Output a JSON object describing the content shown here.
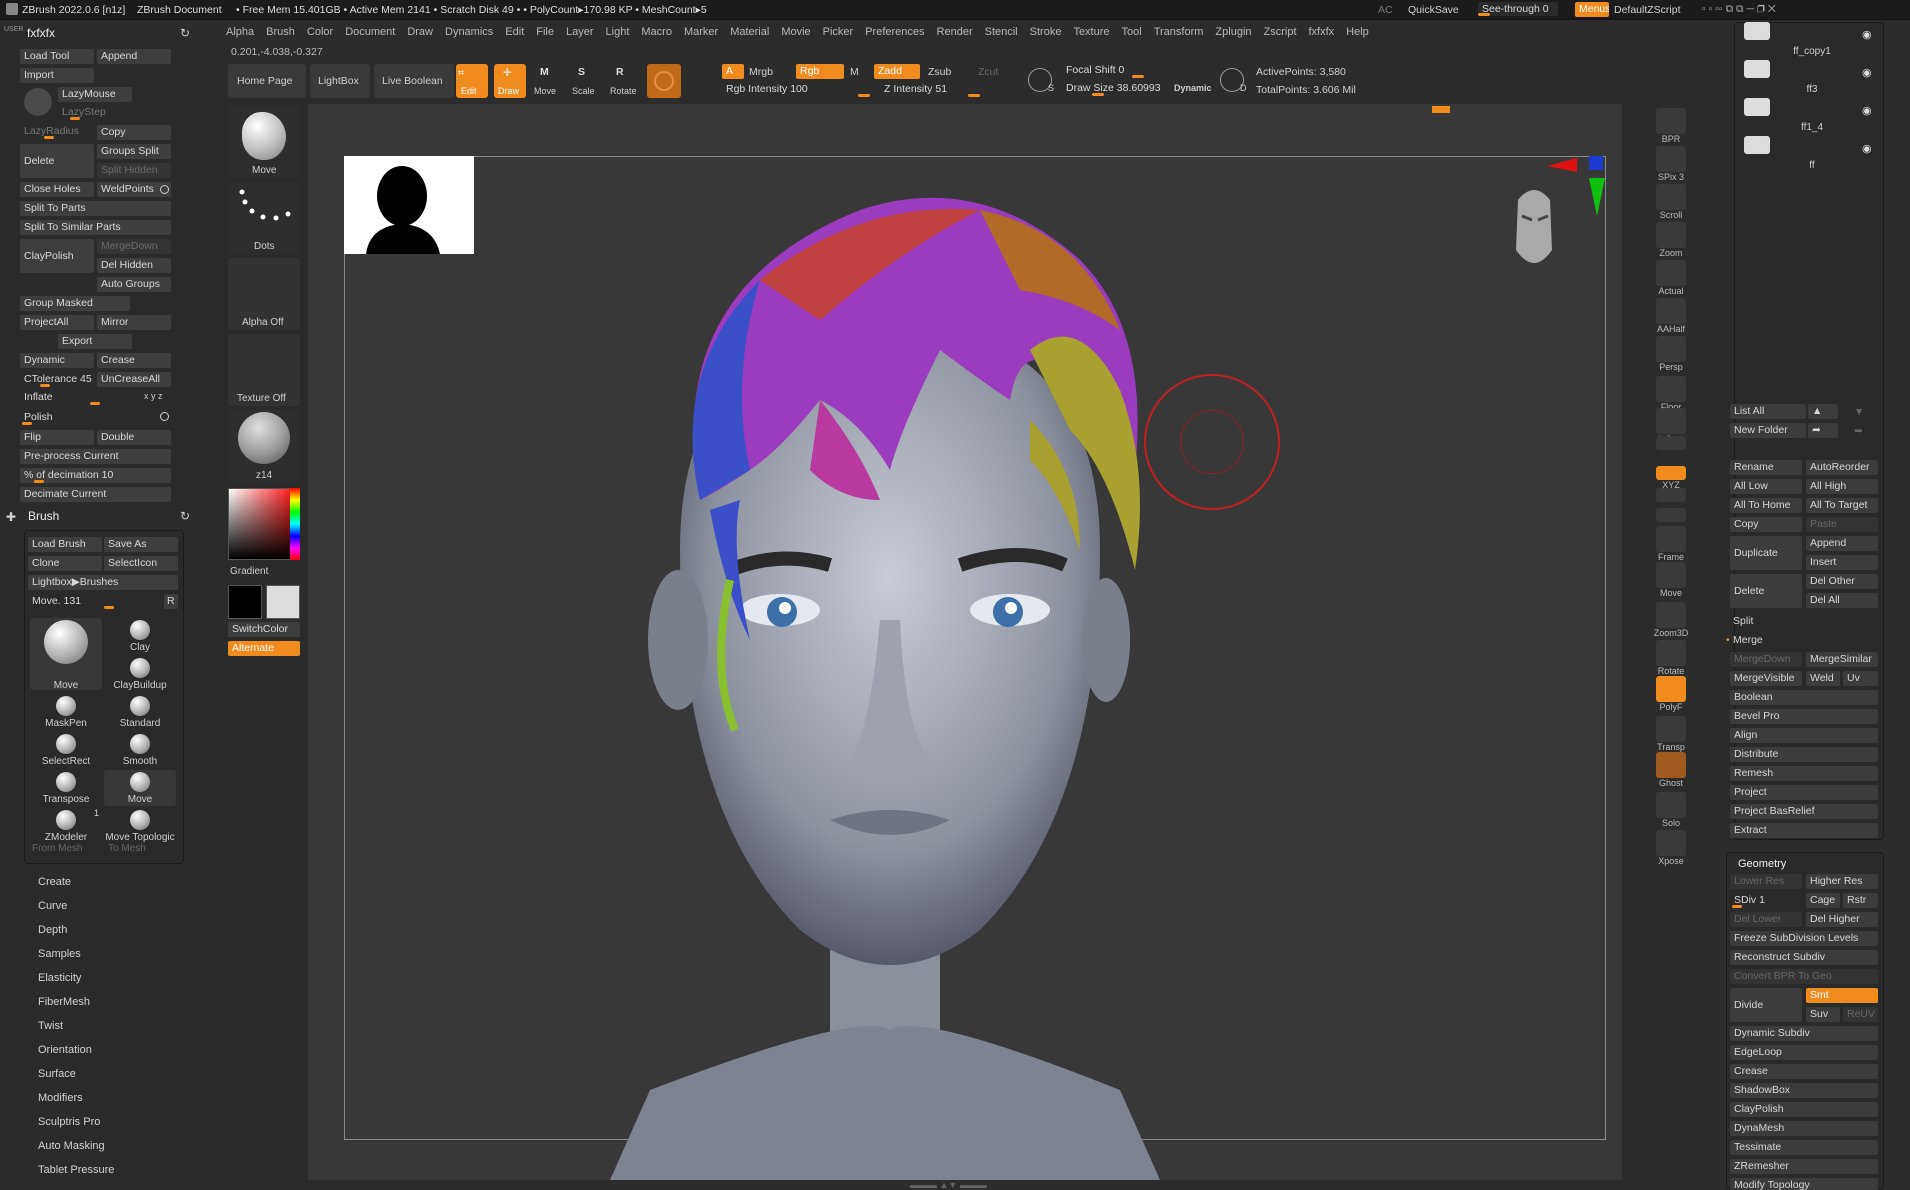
{
  "topbar": {
    "app": "ZBrush 2022.0.6 [n1z]",
    "doc": "ZBrush Document",
    "stats": "• Free Mem 15.401GB • Active Mem 2141 • Scratch Disk 49 •  • PolyCount▸170.98 KP  • MeshCount▸5",
    "ac": "AC",
    "quicksave": "QuickSave",
    "seethrough": "See-through  0",
    "menus": "Menus",
    "script": "DefaultZScript"
  },
  "menus": [
    "Alpha",
    "Brush",
    "Color",
    "Document",
    "Draw",
    "Dynamics",
    "Edit",
    "File",
    "Layer",
    "Light",
    "Macro",
    "Marker",
    "Material",
    "Movie",
    "Picker",
    "Preferences",
    "Render",
    "Stencil",
    "Stroke",
    "Texture",
    "Tool",
    "Transform",
    "Zplugin",
    "Zscript",
    "fxfxfx",
    "Help"
  ],
  "coords": "0.201,-4.038,-0.327",
  "toolbar": {
    "home": "Home Page",
    "lightbox": "LightBox",
    "live_boolean": "Live Boolean",
    "edit": "Edit",
    "draw": "Draw",
    "move": "Move",
    "scale": "Scale",
    "rotate": "Rotate",
    "a": "A",
    "mrgb": "Mrgb",
    "rgb": "Rgb",
    "m": "M",
    "zadd": "Zadd",
    "zsub": "Zsub",
    "zcut": "Zcut",
    "rgb_intensity": "Rgb Intensity  100",
    "z_intensity": "Z Intensity  51",
    "focal_shift": "Focal Shift  0",
    "draw_size": "Draw Size  38.60993",
    "dynamic": "Dynamic",
    "active_points": "ActivePoints: 3,580",
    "total_points": "TotalPoints: 3.606 Mil"
  },
  "left": {
    "title": "fxfxfx",
    "user": "USER",
    "load_tool": "Load Tool",
    "append": "Append",
    "import": "Import",
    "lazymouse": "LazyMouse",
    "lazystep": "LazyStep",
    "lazyradius": "LazyRadius",
    "copy": "Copy",
    "delete": "Delete",
    "groups_split": "Groups Split",
    "split_hidden": "Split Hidden",
    "close_holes": "Close Holes",
    "weldpoints": "WeldPoints",
    "split_to_parts": "Split To Parts",
    "split_similar": "Split To Similar Parts",
    "claypolish": "ClayPolish",
    "mergedown": "MergeDown",
    "del_hidden": "Del Hidden",
    "auto_groups": "Auto Groups",
    "group_masked": "Group Masked",
    "projectall": "ProjectAll",
    "mirror": "Mirror",
    "export": "Export",
    "dynamic": "Dynamic",
    "crease": "Crease",
    "ctolerance": "CTolerance 45",
    "uncreaseall": "UnCreaseAll",
    "inflate": "Inflate",
    "xyz": "x y z",
    "polish": "Polish",
    "flip": "Flip",
    "double": "Double",
    "preprocess": "Pre-process Current",
    "pct_decimation": "% of decimation  10",
    "decimate": "Decimate Current"
  },
  "brush": {
    "title": "Brush",
    "load_brush": "Load Brush",
    "save_as": "Save As",
    "clone": "Clone",
    "selecticon": "SelectIcon",
    "lightbox_brushes": "Lightbox▶Brushes",
    "move_slider": "Move.  131",
    "r": "R",
    "items": [
      "Move",
      "Clay",
      "ClayBuildup",
      "MaskPen",
      "Standard",
      "SelectRect",
      "Smooth",
      "Transpose",
      "Move",
      "ZModeler",
      "Move Topologic"
    ],
    "one": "1",
    "from_mesh": "From Mesh",
    "to_mesh": "To Mesh"
  },
  "left_menu": [
    "Create",
    "Curve",
    "Depth",
    "Samples",
    "Elasticity",
    "FiberMesh",
    "Twist",
    "Orientation",
    "Surface",
    "Modifiers",
    "Sculptris Pro",
    "Auto Masking",
    "Tablet Pressure"
  ],
  "tools": {
    "move": "Move",
    "dots": "Dots",
    "alpha": "Alpha Off",
    "texture": "Texture Off",
    "material": "z14",
    "gradient": "Gradient",
    "switchcolor": "SwitchColor",
    "alternate": "Alternate"
  },
  "right_bar": [
    "BPR",
    "SPix 3",
    "Scroll",
    "Zoom",
    "Actual",
    "AAHalf",
    "Persp",
    "Floor",
    "L.Sym",
    "",
    "XYZ",
    "",
    "",
    "Frame",
    "Move",
    "Zoom3D",
    "Rotate",
    "PolyF",
    "Transp",
    "Ghost",
    "Solo",
    "Xpose"
  ],
  "subtools": {
    "items": [
      "ff_copy1",
      "ff3",
      "ff1_4",
      "ff"
    ]
  },
  "right": {
    "list_all": "List All",
    "new_folder": "New Folder",
    "rename": "Rename",
    "autoreorder": "AutoReorder",
    "all_low": "All Low",
    "all_high": "All High",
    "all_to_home": "All To Home",
    "all_to_target": "All To Target",
    "copy": "Copy",
    "paste": "Paste",
    "duplicate": "Duplicate",
    "append": "Append",
    "insert": "Insert",
    "delete": "Delete",
    "del_other": "Del Other",
    "del_all": "Del All",
    "split": "Split",
    "merge": "Merge",
    "mergedown": "MergeDown",
    "mergesimilar": "MergeSimilar",
    "mergevisible": "MergeVisible",
    "weld": "Weld",
    "uv": "Uv",
    "list": [
      "Boolean",
      "Bevel Pro",
      "Align",
      "Distribute",
      "Remesh",
      "Project",
      "Project BasRelief",
      "Extract"
    ]
  },
  "geometry": {
    "title": "Geometry",
    "lower_res": "Lower Res",
    "higher_res": "Higher Res",
    "sdiv": "SDiv 1",
    "cage": "Cage",
    "rstr": "Rstr",
    "del_lower": "Del Lower",
    "del_higher": "Del Higher",
    "freeze": "Freeze SubDivision Levels",
    "reconstruct": "Reconstruct Subdiv",
    "convert_bpr": "Convert BPR To Geo",
    "divide": "Divide",
    "smt": "Smt",
    "suv": "Suv",
    "reuv": "ReUV",
    "list": [
      "Dynamic Subdiv",
      "EdgeLoop",
      "Crease",
      "ShadowBox",
      "ClayPolish",
      "DynaMesh",
      "Tessimate",
      "ZRemesher",
      "Modify Topology"
    ]
  },
  "colors": {
    "accent": "#f08c1e",
    "bg": "#2c2c2c",
    "panel": "#3e3e3e"
  }
}
